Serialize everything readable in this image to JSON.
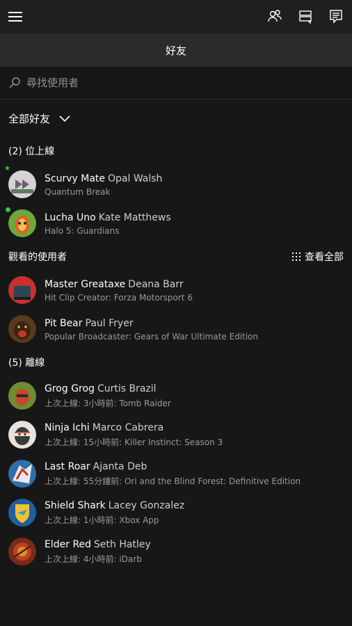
{
  "header": {
    "menu_icon": "hamburger-menu-icon",
    "icons": [
      "people-icon",
      "chat-icon",
      "message-icon"
    ]
  },
  "title": "好友",
  "search": {
    "placeholder": "尋找使用者",
    "value": ""
  },
  "filter": {
    "label": "全部好友",
    "icon": "chevron-down-icon"
  },
  "sections": {
    "online": {
      "title": "(2) 位上線"
    },
    "watching": {
      "title": "觀看的使用者",
      "view_all": "查看全部"
    },
    "offline": {
      "title": "(5) 離線"
    }
  },
  "friends_online": [
    {
      "gamertag": "Scurvy Mate",
      "name": "Opal Walsh",
      "activity": "Quantum Break",
      "presence": "favorite-online",
      "avatar_color": "#d8d2d8"
    },
    {
      "gamertag": "Lucha Uno",
      "name": "Kate Matthews",
      "activity": "Halo 5: Guardians",
      "presence": "online",
      "avatar_color": "#6da83a"
    }
  ],
  "watching": [
    {
      "gamertag": "Master Greataxe",
      "name": "Deana Barr",
      "activity": "Hit Clip Creator: Forza Motorsport 6",
      "avatar_color": "#c8302c"
    },
    {
      "gamertag": "Pit Bear",
      "name": "Paul Fryer",
      "activity": "Popular Broadcaster: Gears of War Ultimate Edition",
      "avatar_color": "#5a3a1c"
    }
  ],
  "friends_offline": [
    {
      "gamertag": "Grog Grog",
      "name": "Curtis Brazil",
      "activity": "上次上線: 3小時前: Tomb Raider",
      "avatar_color": "#6c8d35"
    },
    {
      "gamertag": "Ninja Ichi",
      "name": "Marco Cabrera",
      "activity": "上次上線: 15小時前: Killer Instinct: Season 3",
      "avatar_color": "#e8e3db"
    },
    {
      "gamertag": "Last Roar",
      "name": "Ajanta Deb",
      "activity": "上次上線: 55分鐘前: Ori and the Blind Forest: Definitive Edition",
      "avatar_color": "#2f6ea8"
    },
    {
      "gamertag": "Shield Shark",
      "name": "Lacey Gonzalez",
      "activity": "上次上線: 1小時前: Xbox App",
      "avatar_color": "#1f5f9e"
    },
    {
      "gamertag": "Elder Red",
      "name": "Seth Hatley",
      "activity": "上次上線: 4小時前: iDarb",
      "avatar_color": "#7a2a18"
    }
  ]
}
